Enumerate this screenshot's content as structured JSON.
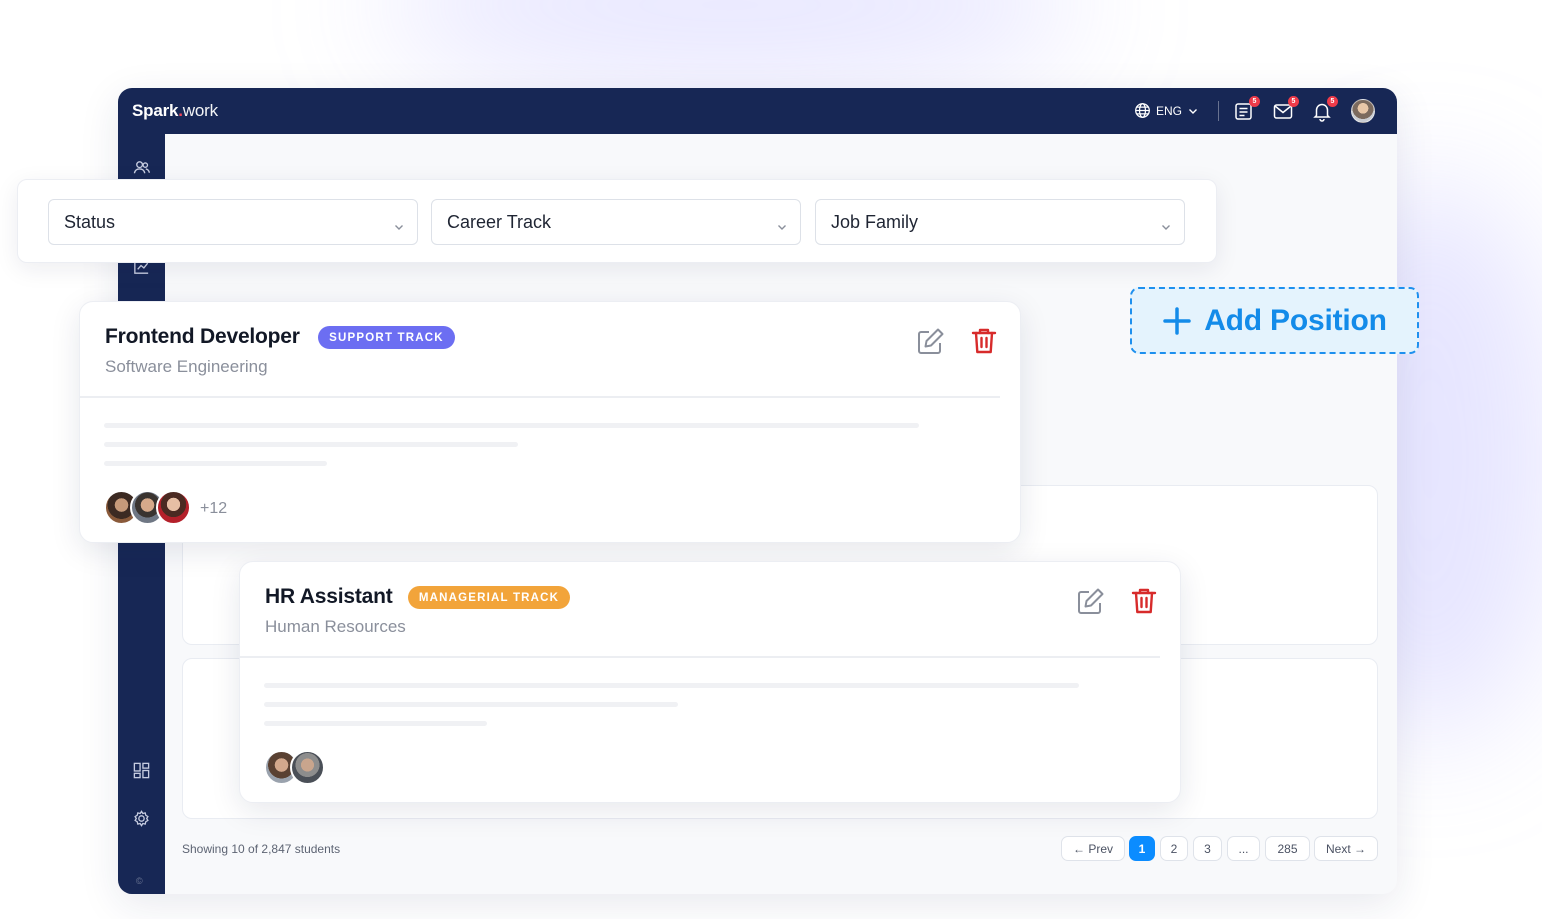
{
  "app": {
    "brand_bold": "Spark",
    "brand_dot": ".",
    "brand_light": "work",
    "language": "ENG",
    "notifications": {
      "tasks_count": "5",
      "messages_count": "5",
      "alerts_count": "5"
    }
  },
  "sidebar": {
    "copyright": "©",
    "icons": [
      "users-icon",
      "chart-icon",
      "dashboard-icon",
      "settings-icon"
    ]
  },
  "filters": [
    {
      "label": "Status"
    },
    {
      "label": "Career Track"
    },
    {
      "label": "Job Family"
    }
  ],
  "add_position": {
    "label": "Add Position"
  },
  "positions": [
    {
      "title": "Frontend Developer",
      "track": "SUPPORT TRACK",
      "track_color": "#6c6ef2",
      "family": "Software Engineering",
      "extra_members": "+12"
    },
    {
      "title": "HR Assistant",
      "track": "MANAGERIAL TRACK",
      "track_color": "#f2a43a",
      "family": "Human Resources",
      "extra_members": ""
    }
  ],
  "footer": {
    "showing_text": "Showing 10 of 2,847 students",
    "pagination": {
      "prev": "← Prev",
      "pages": [
        "1",
        "2",
        "3",
        "...",
        "285"
      ],
      "current": "1",
      "next": "Next →"
    }
  },
  "colors": {
    "navy": "#172755",
    "accent_blue": "#138be9",
    "delete_red": "#d72b2b",
    "edit_gray": "#8a8f9b"
  }
}
